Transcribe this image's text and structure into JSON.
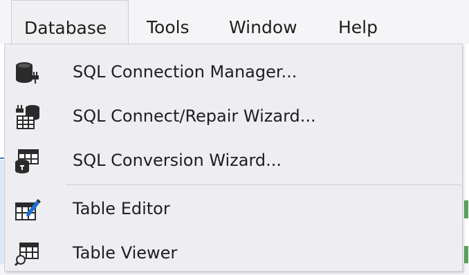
{
  "menubar": {
    "items": [
      {
        "label": "Database"
      },
      {
        "label": "Tools"
      },
      {
        "label": "Window"
      },
      {
        "label": "Help"
      }
    ]
  },
  "dropdown": {
    "items": [
      {
        "label": "SQL Connection Manager...",
        "icon": "database-plug-icon"
      },
      {
        "label": "SQL Connect/Repair Wizard...",
        "icon": "connect-repair-wizard-icon"
      },
      {
        "label": "SQL Conversion Wizard...",
        "icon": "conversion-wizard-icon"
      },
      {
        "label": "Table Editor",
        "icon": "table-edit-icon"
      },
      {
        "label": "Table Viewer",
        "icon": "table-viewer-icon"
      }
    ]
  },
  "colors": {
    "menu_bg": "#eeeef2",
    "border": "#ccced4",
    "text": "#1e1e1e",
    "accent": "#1f6fd1"
  }
}
